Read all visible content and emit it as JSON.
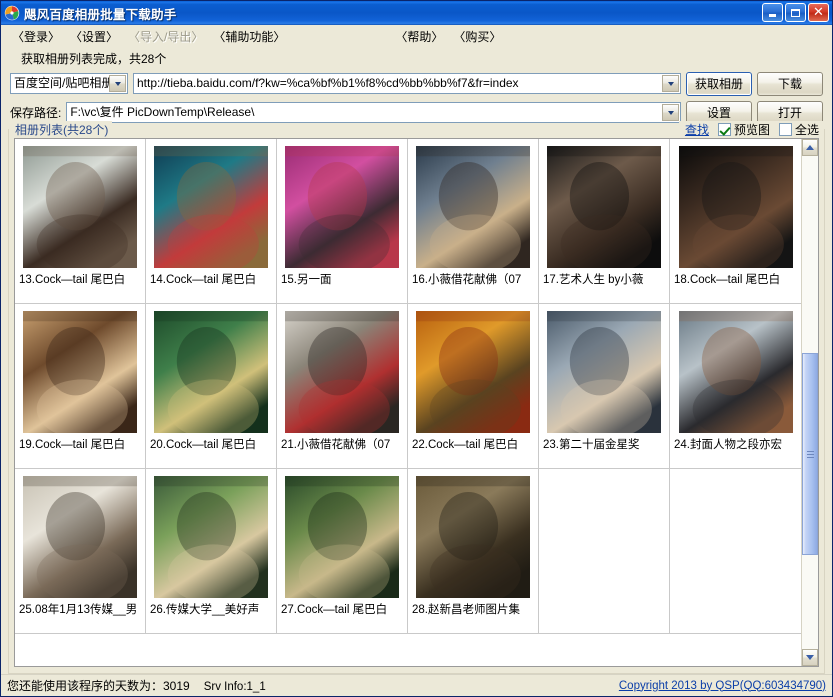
{
  "window": {
    "title": "飓风百度相册批量下载助手",
    "icon": "app-flower-icon",
    "minimize_label": "",
    "maximize_label": "",
    "close_label": "✕"
  },
  "menu": {
    "items": [
      {
        "label": "〈登录〉",
        "disabled": false
      },
      {
        "label": "〈设置〉",
        "disabled": false
      },
      {
        "label": "〈导入/导出〉",
        "disabled": true
      },
      {
        "label": "〈辅助功能〉",
        "disabled": false
      }
    ],
    "right_items": [
      {
        "label": "〈帮助〉",
        "disabled": false
      },
      {
        "label": "〈购买〉",
        "disabled": false
      }
    ]
  },
  "status_message": "获取相册列表完成，共28个",
  "toolbar": {
    "source_select": "百度空间/贴吧相册",
    "url_value": "http://tieba.baidu.com/f?kw=%ca%bf%b1%f8%cd%bb%bb%f7&fr=index",
    "get_album_button": "获取相册",
    "download_button": "下载",
    "path_label": "保存路径:",
    "path_value": "F:\\vc\\复件 PicDownTemp\\Release\\",
    "settings_button": "设置",
    "open_button": "打开"
  },
  "album_group": {
    "title": "相册列表(共28个)",
    "find_link": "查找",
    "preview_checkbox": {
      "label": "预览图",
      "checked": true
    },
    "selectall_checkbox": {
      "label": "全选",
      "checked": false
    }
  },
  "albums": [
    {
      "caption": "13.Cock—tail 尾巴白",
      "palette": [
        "#8f9a93",
        "#d8dcd6",
        "#3a2b22",
        "#6b5a4a"
      ]
    },
    {
      "caption": "14.Cock—tail 尾巴白",
      "palette": [
        "#0f3b52",
        "#1f7a86",
        "#c23b3b",
        "#8a6a3a"
      ]
    },
    {
      "caption": "15.另一面",
      "palette": [
        "#9a2c74",
        "#d24fa0",
        "#3d2b33",
        "#b8374a"
      ]
    },
    {
      "caption": "16.小薇借花献佛（07",
      "palette": [
        "#2a3a4a",
        "#6f7f8f",
        "#c9b08a",
        "#2f2620"
      ]
    },
    {
      "caption": "17.艺术人生 by小薇",
      "palette": [
        "#1a1a1a",
        "#6d5a4a",
        "#3a2c22",
        "#0d0d0d"
      ]
    },
    {
      "caption": "18.Cock—tail 尾巴白",
      "palette": [
        "#0a0a0a",
        "#3a2a20",
        "#6a4a34",
        "#141414"
      ]
    },
    {
      "caption": "19.Cock—tail 尾巴白",
      "palette": [
        "#c8a070",
        "#6e4a2c",
        "#e0c49a",
        "#3a2618"
      ]
    },
    {
      "caption": "20.Cock—tail 尾巴白",
      "palette": [
        "#1d4a2a",
        "#3f7f4a",
        "#d0c07a",
        "#14301c"
      ]
    },
    {
      "caption": "21.小薇借花献佛（07",
      "palette": [
        "#d8d4cc",
        "#8a8478",
        "#b03030",
        "#2a2622"
      ]
    },
    {
      "caption": "22.Cock—tail 尾巴白",
      "palette": [
        "#b8600f",
        "#e09a2a",
        "#5a4320",
        "#8a2a12"
      ]
    },
    {
      "caption": "23.第二十届金星奖",
      "palette": [
        "#4a5a6a",
        "#9aa8b4",
        "#d8c8b0",
        "#2a323c"
      ]
    },
    {
      "caption": "24.封面人物之段亦宏",
      "palette": [
        "#6a7a86",
        "#b8c2c8",
        "#2a2a2e",
        "#8a5a3a"
      ]
    },
    {
      "caption": "25.08年1月13传媒__男",
      "palette": [
        "#c8c2b4",
        "#e8e4da",
        "#7a6a58",
        "#3a3228"
      ]
    },
    {
      "caption": "26.传媒大学__美好声",
      "palette": [
        "#3a5a3a",
        "#7aa05a",
        "#d8c8a0",
        "#22301e"
      ]
    },
    {
      "caption": "27.Cock—tail 尾巴白",
      "palette": [
        "#2a4a2a",
        "#6a8a4a",
        "#c8b88a",
        "#1a2a18"
      ]
    },
    {
      "caption": "28.赵新昌老师图片集",
      "palette": [
        "#6a5a3a",
        "#8a7a5a",
        "#3a3020",
        "#201c14"
      ]
    }
  ],
  "empty_cells": 2,
  "scrollbar": {
    "thumb_top_pct": 40,
    "thumb_height_pct": 41
  },
  "statusbar": {
    "days_text": "您还能使用该程序的天数为：3019",
    "srv_text": "Srv Info:1_1",
    "copyright": "Copyright 2013 by QSP(QQ:603434790)"
  },
  "colors": {
    "title_bar": "#0a57c8",
    "face": "#ece9d8",
    "link": "#0b3ea8",
    "group_title": "#2b4a8b"
  }
}
